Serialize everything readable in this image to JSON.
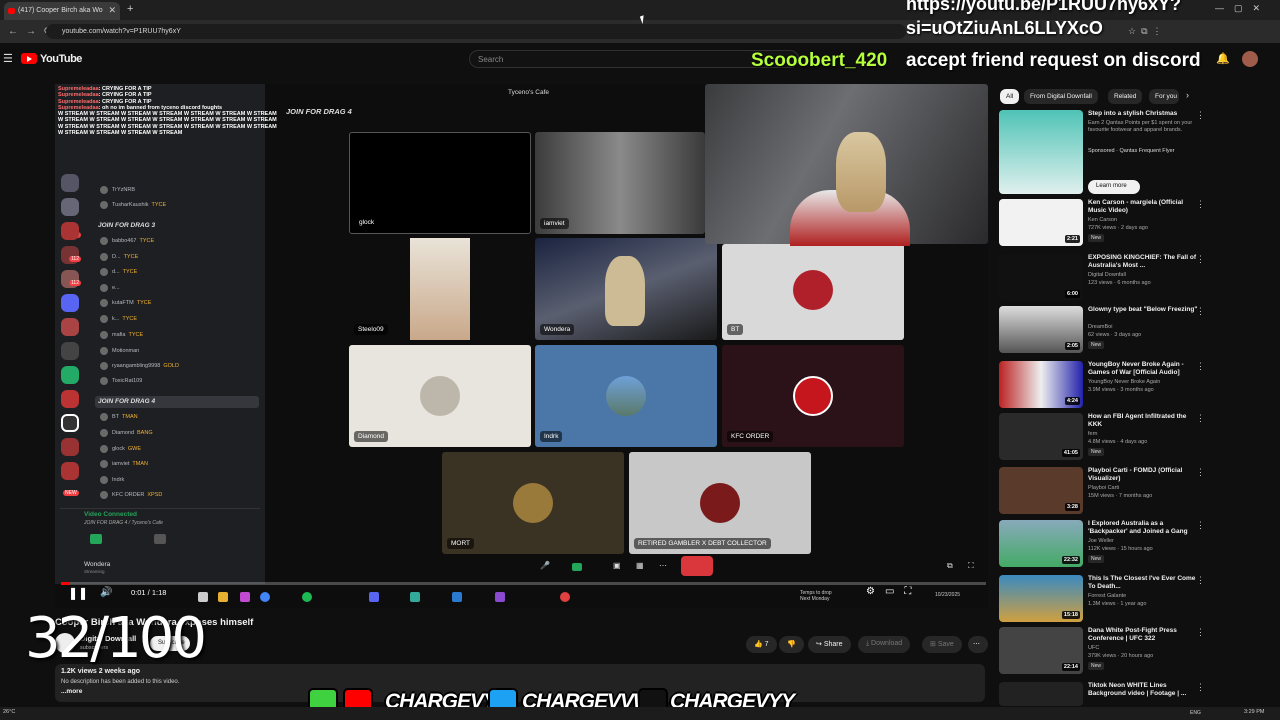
{
  "browser": {
    "tab_title": "(417) Cooper Birch aka Wo",
    "url": "youtube.com/watch?v=P1RUU7hy6xY"
  },
  "youtube": {
    "logo_text": "YouTube",
    "search_placeholder": "Search"
  },
  "stream_overlay": {
    "line1": "https://youtu.be/P1RUU7hy6xY?",
    "line2": "si=uOtZiuAnL6LLYXcO",
    "username": "Scooobert_420",
    "message": "accept friend request on discord"
  },
  "counter_overlay": "32/100",
  "discord": {
    "chat_lines": [
      {
        "user": "Supremeleadaa",
        "text": ": CRYING FOR A TIP"
      },
      {
        "user": "Supremeleadaa",
        "text": ": CRYING FOR A TIP"
      },
      {
        "user": "Supremeleadaa",
        "text": ": CRYING FOR A TIP"
      },
      {
        "user": "Supremeleadaa",
        "text": ": oh no im banned from tyceno discord foughts"
      },
      {
        "user": "",
        "text": "W STREAM W STREAM W STREAM W STREAM W STREAM W STREAM W STREAM W STREAM W STREAM W STREAM W STREAM W STREAM W STREAM W STREAM W STREAM W STREAM W STREAM W STREAM W STREAM W STREAM W STREAM W STREAM W STREAM W STREAM W STREAM"
      }
    ],
    "channel_join3": "JOIN FOR DRAG 3",
    "channel_join4": "JOIN FOR DRAG 4",
    "members_top": [
      {
        "name": "TrYzNRB",
        "tag": ""
      },
      {
        "name": "TusharKaushik",
        "tag": "TYCE"
      }
    ],
    "members_drag3": [
      {
        "name": "babbo467",
        "tag": "TYCE"
      },
      {
        "name": "D...",
        "tag": "TYCE"
      },
      {
        "name": "d...",
        "tag": "TYCE"
      },
      {
        "name": "e...",
        "tag": ""
      },
      {
        "name": "kutaFTM",
        "tag": "TYCE"
      },
      {
        "name": "k...",
        "tag": "TYCE"
      },
      {
        "name": "mafia",
        "tag": "TYCE"
      },
      {
        "name": "Motionman",
        "tag": ""
      },
      {
        "name": "ryaangambling9998",
        "tag": "GOLD"
      },
      {
        "name": "ToxicRat109",
        "tag": "TYCE"
      }
    ],
    "members_drag4": [
      {
        "name": "BT",
        "tag": "TMAN"
      },
      {
        "name": "Diamond",
        "tag": "BANG"
      },
      {
        "name": "glock",
        "tag": "GWE"
      },
      {
        "name": "iamviet",
        "tag": "TMAN"
      },
      {
        "name": "Indrk",
        "tag": ""
      },
      {
        "name": "KFC ORDER",
        "tag": "XPSD"
      }
    ],
    "server_badges": [
      "171",
      "112",
      "112"
    ],
    "new_badge": "NEW",
    "voice_connected": "Video Connected",
    "voice_sub": "JOIN FOR DRAG 4 / Tyceno's Cafe",
    "current_user": "Wondera",
    "current_user_status": "Streaming"
  },
  "call": {
    "server_name": "Tyceno's Cafe",
    "channel_title": "JOIN FOR DRAG 4",
    "tiles": [
      "glock",
      "iamviet",
      "Steelo09",
      "Wondera",
      "BT",
      "Diamond",
      "Indrk",
      "KFC ORDER",
      "MORT",
      "RETIRED GAMBLER X DEBT COLLECTOR"
    ]
  },
  "player": {
    "time": "0:01 / 1:18",
    "progress_fraction": 0.01,
    "temp_line1": "Temps to drop",
    "temp_line2": "Next Monday",
    "inner_clock": "10/23/2025"
  },
  "video": {
    "title": "Cooper Birch aka Wondera exposes himself",
    "channel": "Digital Downfall",
    "subs": "subscribers",
    "subscribe_label": "Subscribe",
    "likes": "7",
    "share_label": "Share",
    "download_label": "Download",
    "save_label": "Save",
    "views": "1.2K views  2 weeks ago",
    "no_description": "No description has been added to this video.",
    "more_label": "...more"
  },
  "social": {
    "handle1": "CHARGEVYY",
    "handle2": "CHARGEVVW",
    "handle3": "CHARGEVYY"
  },
  "chips": [
    "All",
    "From Digital Downfall",
    "Related",
    "For you"
  ],
  "recommendations": [
    {
      "title": "Step into a stylish Christmas",
      "meta1": "Earn 2 Qantas Points per $1 spent on your favourite footwear and apparel brands.",
      "meta2": "Sponsored · Qantas Frequent Flyer",
      "duration": "",
      "is_ad": true,
      "cta": "Learn more"
    },
    {
      "title": "Ken Carson - margiela (Official Music Video)",
      "meta1": "Ken Carson",
      "meta2": "727K views · 2 days ago",
      "duration": "2:21",
      "new": "New"
    },
    {
      "title": "EXPOSING KINGCHIEF: The Fall of Australia's Most ...",
      "meta1": "Digital Downfall",
      "meta2": "123 views · 6 months ago",
      "duration": "6:00",
      "new": ""
    },
    {
      "title": "Glowny type beat \"Below Freezing\"",
      "meta1": "DreamBoi",
      "meta2": "62 views · 3 days ago",
      "duration": "2:05",
      "new": "New"
    },
    {
      "title": "YoungBoy Never Broke Again - Games of War [Official Audio]",
      "meta1": "YoungBoy Never Broke Again",
      "meta2": "3.9M views · 3 months ago",
      "duration": "4:24",
      "new": ""
    },
    {
      "title": "How an FBI Agent Infiltrated the KKK",
      "meta1": "fern",
      "meta2": "4.8M views · 4 days ago",
      "duration": "41:05",
      "new": "New"
    },
    {
      "title": "Playboi Carti - FOMDJ (Official Visualizer)",
      "meta1": "Playboi Carti",
      "meta2": "15M views · 7 months ago",
      "duration": "3:28",
      "new": ""
    },
    {
      "title": "I Explored Australia as a 'Backpacker' and Joined a Gang",
      "meta1": "Joe Weller",
      "meta2": "112K views · 15 hours ago",
      "duration": "22:32",
      "new": "New"
    },
    {
      "title": "This Is The Closest I've Ever Come To Death...",
      "meta1": "Forrest Galante",
      "meta2": "1.3M views · 1 year ago",
      "duration": "15:18",
      "new": ""
    },
    {
      "title": "Dana White Post-Fight Press Conference | UFC 322",
      "meta1": "UFC",
      "meta2": "379K views · 20 hours ago",
      "duration": "22:14",
      "new": "New"
    },
    {
      "title": "Tiktok Neon WHITE Lines Background video | Footage | ...",
      "meta1": "",
      "meta2": "",
      "duration": "",
      "new": ""
    }
  ],
  "taskbar": {
    "weather": "26°C",
    "lang": "ENG",
    "time": "3:29 PM"
  },
  "colors": {
    "youtube_red": "#ff0000",
    "overlay_green": "#b4ff3a",
    "discord_bg": "#1e1f22",
    "hangup_red": "#da373c"
  }
}
